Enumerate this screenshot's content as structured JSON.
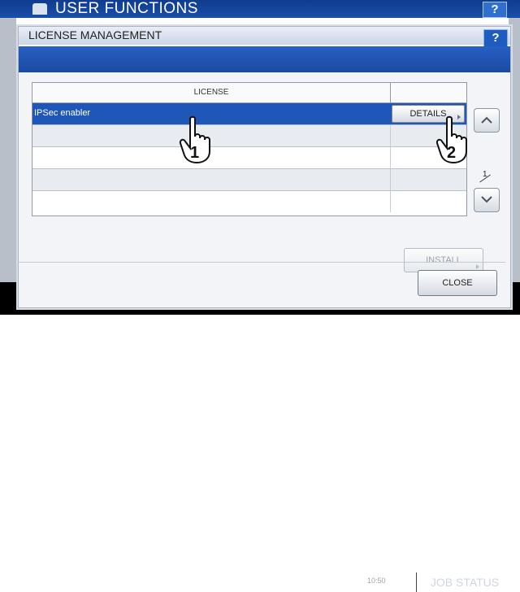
{
  "background": {
    "title": "USER FUNCTIONS",
    "help_label": "?",
    "time": "10:50",
    "job_status_label": "JOB STATUS"
  },
  "dialog": {
    "title": "LICENSE MANAGEMENT",
    "help_label": "?",
    "table": {
      "header": "LICENSE",
      "rows": [
        {
          "license": "IPSec enabler",
          "action": "DETAILS",
          "selected": true
        },
        {
          "license": "",
          "action": ""
        },
        {
          "license": "",
          "action": ""
        },
        {
          "license": "",
          "action": ""
        },
        {
          "license": "",
          "action": ""
        }
      ]
    },
    "pagination": {
      "current": "1",
      "total": "1"
    },
    "install_label": "INSTALL",
    "close_label": "CLOSE"
  },
  "annotations": {
    "step1": "1",
    "step2": "2"
  },
  "colors": {
    "accent_blue": "#1f57b8",
    "title_bar": "#0f3c8e"
  }
}
